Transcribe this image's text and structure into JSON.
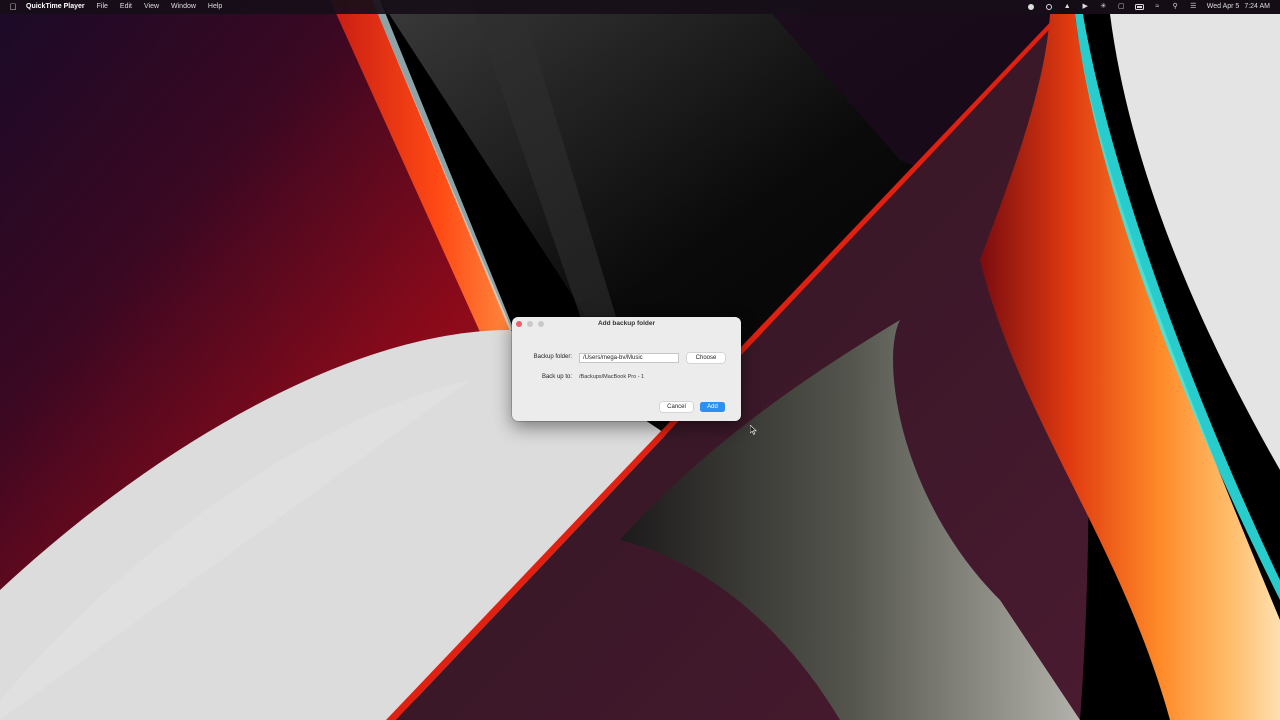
{
  "menubar": {
    "apple_icon": "apple-logo",
    "app_name": "QuickTime Player",
    "menus": [
      "File",
      "Edit",
      "Window",
      "View",
      "Help"
    ],
    "menus_in_order": [
      "File",
      "Edit",
      "View",
      "Window",
      "Help"
    ],
    "status_icons": [
      "record-icon",
      "user-switch-icon",
      "vpn-icon",
      "play-circle-icon",
      "bluetooth-icon",
      "screen-mirror-icon",
      "battery-icon",
      "wifi-icon",
      "search-icon",
      "control-center-icon"
    ],
    "date": "Wed Apr 5",
    "time": "7:24 AM"
  },
  "dialog": {
    "title": "Add backup folder",
    "backup_folder_label": "Backup folder:",
    "backup_folder_value": "/Users/mega-bv/Music",
    "choose_label": "Choose",
    "back_up_to_label": "Back up to:",
    "back_up_to_value": "/Backups/MacBook Pro - 1",
    "cancel_label": "Cancel",
    "add_label": "Add",
    "accent_color": "#2d8ff0",
    "close_color": "#ec5f6a"
  }
}
